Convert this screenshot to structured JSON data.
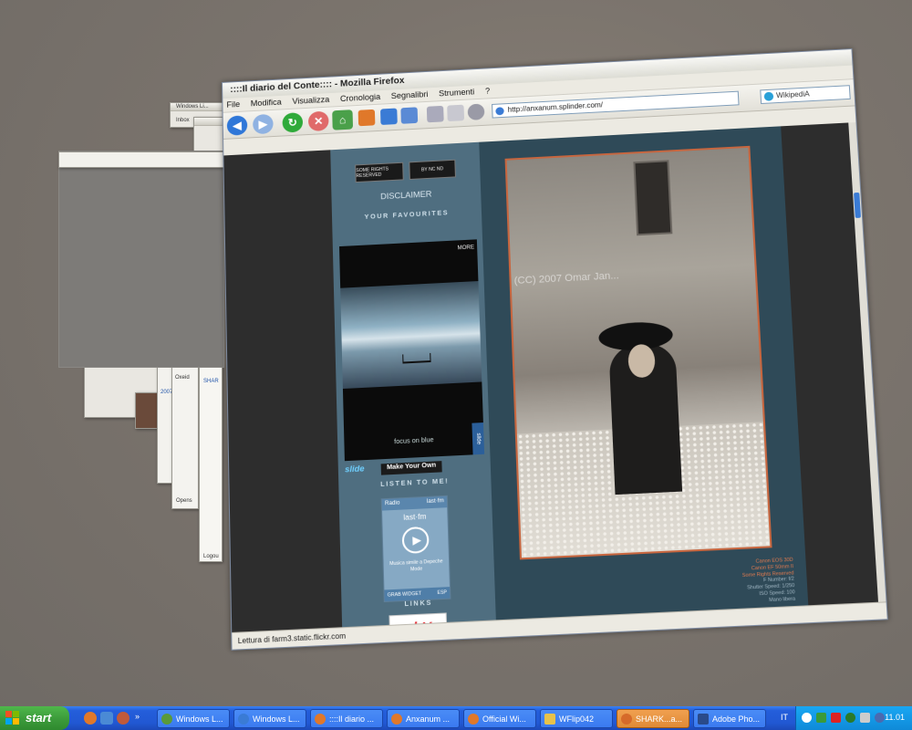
{
  "firefox": {
    "title": "::::Il diario del Conte:::: - Mozilla Firefox",
    "menus": [
      "File",
      "Modifica",
      "Visualizza",
      "Cronologia",
      "Segnalibri",
      "Strumenti",
      "?"
    ],
    "url": "http://anxanum.splinder.com/",
    "search_value": "WikipediA",
    "status": "Lettura di farm3.static.flickr.com"
  },
  "page": {
    "disclaimer": "DISCLAIMER",
    "favourites_heading": "YOUR FAVOURITES",
    "cc_badge_1": "SOME RIGHTS RESERVED",
    "cc_badge_2": "BY NC ND",
    "widget_more": "MORE",
    "widget_caption": "focus on blue",
    "widget_vtab": "slide",
    "slide_logo": "slide",
    "make_your_own": "Make Your Own",
    "listen_heading": "LISTEN TO ME!",
    "lastfm_radio": "Radio",
    "lastfm_small_logo": "last·fm",
    "lastfm_logo": "last·fm",
    "lastfm_message": "Musica simile a Depeche Mode",
    "lastfm_get_widget": "GRAB WIDGET",
    "lastfm_tag": "ESP",
    "links_heading": "LINKS",
    "ebay_logo": "ebY",
    "photo_watermark": "(CC) 2007 Omar Jan...",
    "exif": [
      "Canon EOS 30D",
      "Canon EF 50mm II",
      "Some Rights Reserved",
      "F Number: f/2",
      "Shutter Speed: 1/250",
      "ISO Speed: 100",
      "Mano libera"
    ]
  },
  "background_windows": {
    "window_live_title": "Windows Li...",
    "inbox_label": "Inbox",
    "year_label": "2007",
    "shark_label": "SHAR",
    "sidebar_label": "Oxeid",
    "open_label": "Opens",
    "logout_label": "Logou"
  },
  "taskbar": {
    "start_label": "start",
    "tasks": [
      {
        "label": "Windows L...",
        "color": "#5a9a3a"
      },
      {
        "label": "Windows L...",
        "color": "#3a7bd5"
      },
      {
        "label": "::::Il diario ...",
        "color": "#e0782a"
      },
      {
        "label": "Anxanum ...",
        "color": "#e0782a"
      },
      {
        "label": "Official Wi...",
        "color": "#e0782a"
      },
      {
        "label": "WFlip042",
        "color": "#e7c24a"
      },
      {
        "label": "SHARK...a...",
        "color": "#d66a2a"
      },
      {
        "label": "Adobe Pho...",
        "color": "#2a4a8a"
      }
    ],
    "language": "IT",
    "clock": "11.01"
  },
  "colors": {
    "accent": "#c7663f",
    "xp_blue": "#245edb",
    "start_green": "#3b9a3a"
  }
}
